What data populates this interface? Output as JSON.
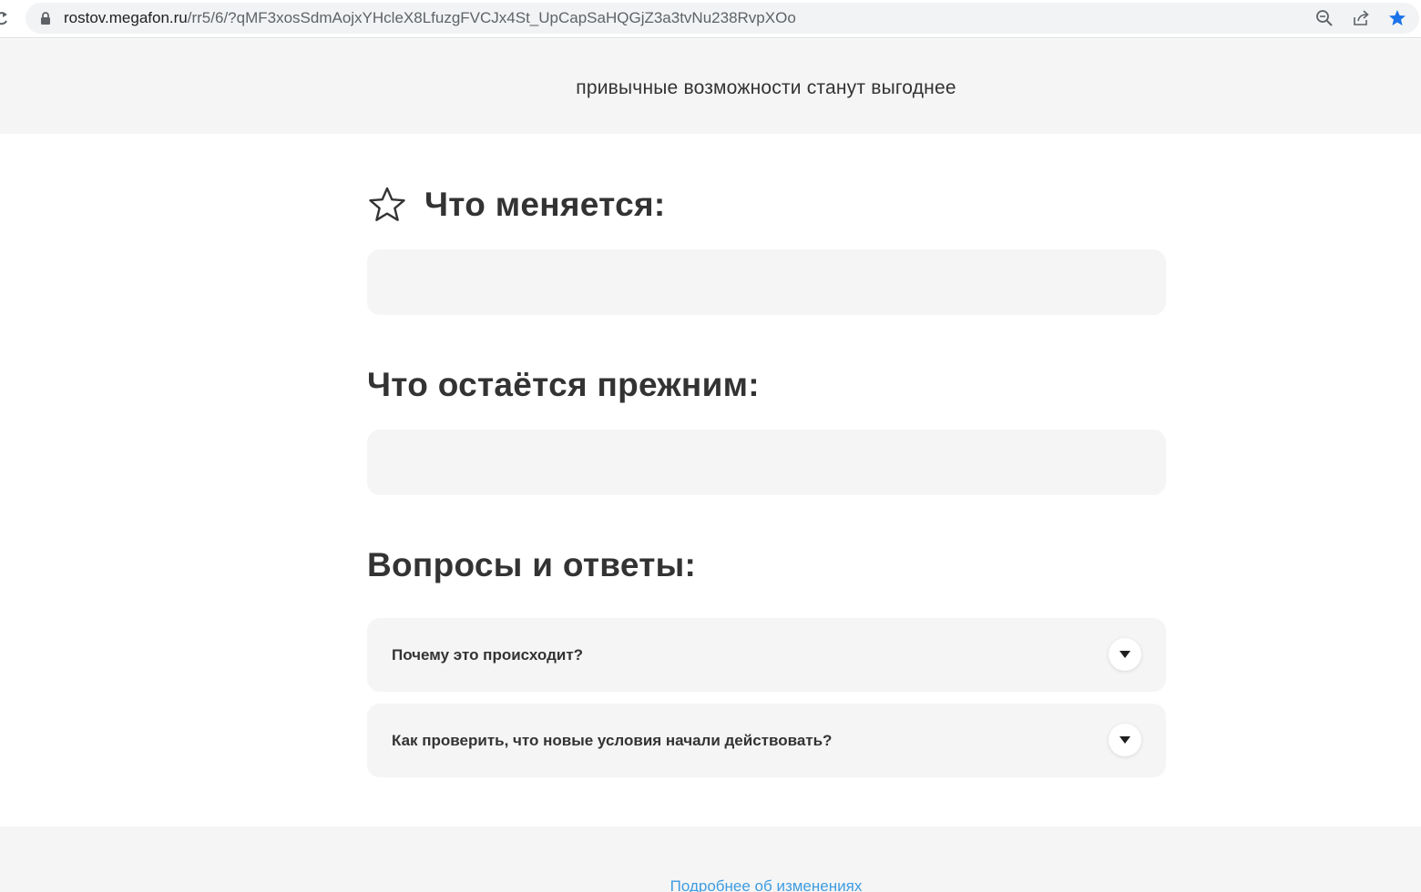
{
  "browser": {
    "url_host": "rostov.megafon.ru",
    "url_path": "/rr5/6/?qMF3xosSdmAojxYHcleX8LfuzgFVCJx4St_UpCapSaHQGjZ3a3tvNu238RvpXOo",
    "icons": [
      "reload-icon",
      "lock-icon",
      "zoom-icon",
      "share-icon",
      "star-bookmark-icon"
    ]
  },
  "top_band": {
    "text": "привычные возможности станут выгоднее"
  },
  "sections": {
    "changes": {
      "title": "Что меняется:",
      "icon": "star-outline-icon"
    },
    "unchanged": {
      "title": "Что остаётся прежним:"
    },
    "faq": {
      "title": "Вопросы и ответы:",
      "items": [
        {
          "question": "Почему это происходит?"
        },
        {
          "question": "Как проверить, что новые условия начали действовать?"
        }
      ]
    }
  },
  "footer": {
    "link": "Подробнее об изменениях"
  },
  "colors": {
    "text": "#333333",
    "band_bg": "#f5f5f5",
    "link": "#3e9ce0",
    "bookmark_star": "#1a73e8"
  }
}
